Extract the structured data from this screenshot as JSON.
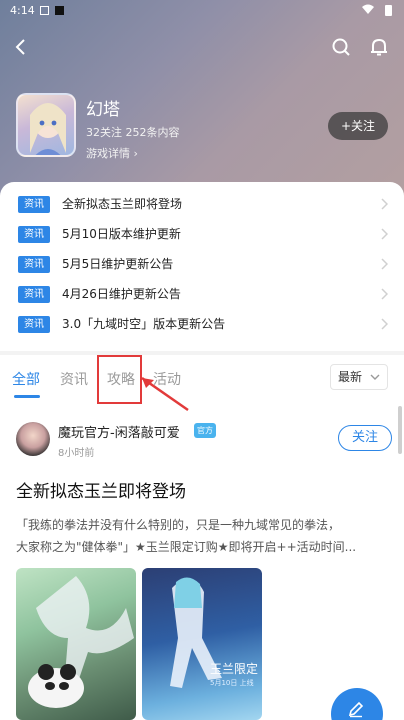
{
  "status_bar": {
    "time": "4:14"
  },
  "game": {
    "title": "幻塔",
    "stats": "32关注 252条内容",
    "details_link": "游戏详情 ›",
    "follow_label": "+关注"
  },
  "news": [
    {
      "tag": "资讯",
      "text": "全新拟态玉兰即将登场"
    },
    {
      "tag": "资讯",
      "text": "5月10日版本维护更新"
    },
    {
      "tag": "资讯",
      "text": "5月5日维护更新公告"
    },
    {
      "tag": "资讯",
      "text": "4月26日维护更新公告"
    },
    {
      "tag": "资讯",
      "text": "3.0「九域时空」版本更新公告"
    }
  ],
  "tabs": [
    "全部",
    "资讯",
    "攻略",
    "活动"
  ],
  "sort": {
    "selected": "最新"
  },
  "post": {
    "author": "魔玩官方-闲落敲可爱",
    "badge": "官方",
    "time": "8小时前",
    "follow_label": "关注",
    "title": "全新拟态玉兰即将登场",
    "excerpt_line1": "「我练的拳法并没有什么特别的，只是一种九域常见的拳法，",
    "excerpt_line2": "大家称之为\"健体拳\"」★玉兰限定订购★即将开启++活动时间...",
    "image2_text": "玉兰限定",
    "image2_sub": "5月10日 上线"
  },
  "colors": {
    "accent": "#2d86e6",
    "highlight": "#e23a3a"
  }
}
